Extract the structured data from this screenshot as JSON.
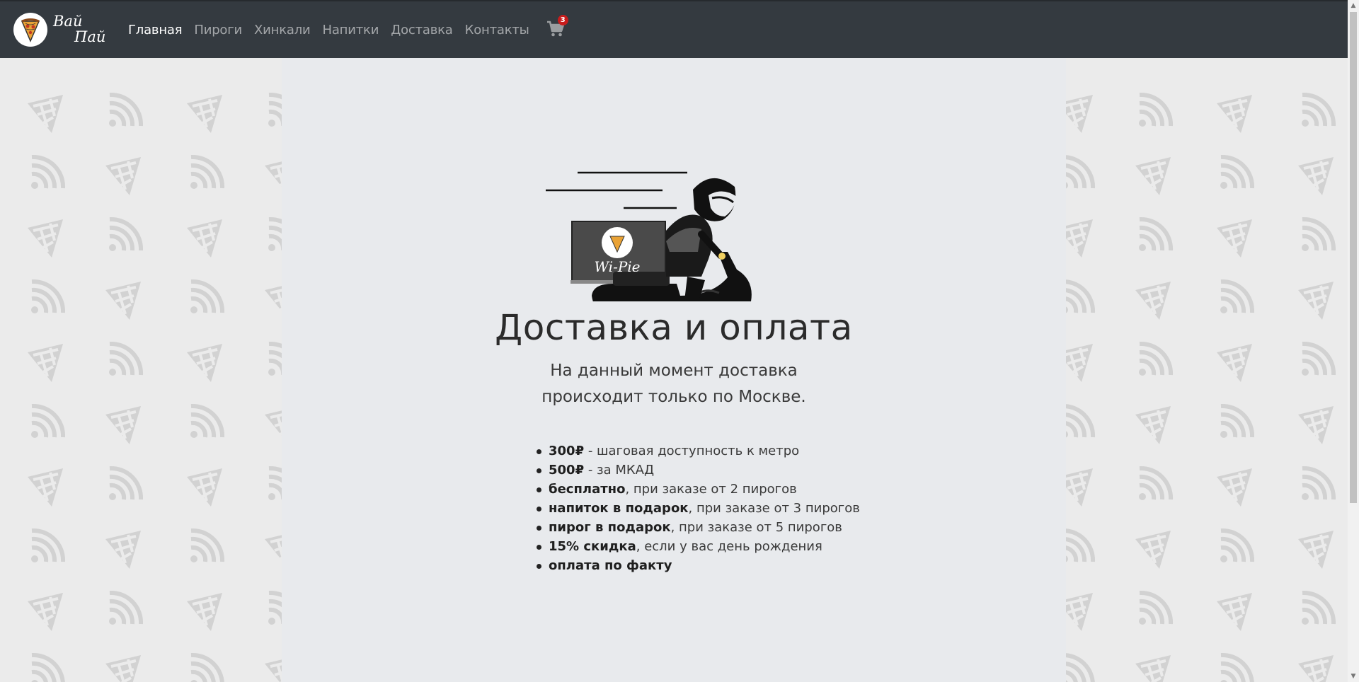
{
  "brand": {
    "line1": "Вай",
    "line2": "Пай"
  },
  "nav": {
    "items": [
      {
        "label": "Главная",
        "active": true
      },
      {
        "label": "Пироги",
        "active": false
      },
      {
        "label": "Хинкали",
        "active": false
      },
      {
        "label": "Напитки",
        "active": false
      },
      {
        "label": "Доставка",
        "active": false
      },
      {
        "label": "Контакты",
        "active": false
      }
    ],
    "cart_count": "3",
    "cart_icon": "shopping-cart-icon"
  },
  "hero": {
    "box_label": "Wi-Pie",
    "title": "Доставка и оплата",
    "subtitle_line1": "На данный момент доставка",
    "subtitle_line2": "происходит только по Москве."
  },
  "terms": [
    {
      "bold": "300₽",
      "text": " - шаговая доступность к метро"
    },
    {
      "bold": "500₽",
      "text": " - за МКАД"
    },
    {
      "bold": "бесплатно",
      "text": ", при заказе от 2 пирогов"
    },
    {
      "bold": "напиток в подарок",
      "text": ", при заказе от 3 пирогов"
    },
    {
      "bold": "пирог в подарок",
      "text": ", при заказе от 5 пирогов"
    },
    {
      "bold": "15% скидка",
      "text": ", если у вас день рождения"
    },
    {
      "bold": "оплата по факту",
      "text": ""
    }
  ],
  "colors": {
    "navbar": "#343a40",
    "panel": "#e8eaed",
    "background": "#ebebeb",
    "badge": "#c91c1c"
  }
}
